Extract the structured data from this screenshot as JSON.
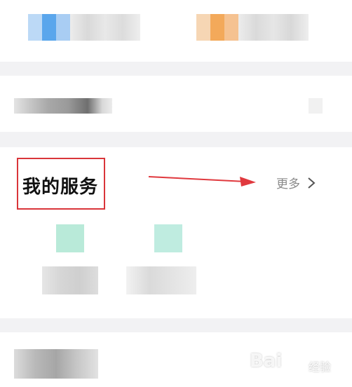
{
  "services": {
    "title": "我的服务",
    "more_label": "更多"
  },
  "watermark": {
    "brand": "Bai",
    "sub": "经验"
  },
  "colors": {
    "annotation_red": "#d9353a",
    "service_icon_teal": "#b9ead9"
  }
}
